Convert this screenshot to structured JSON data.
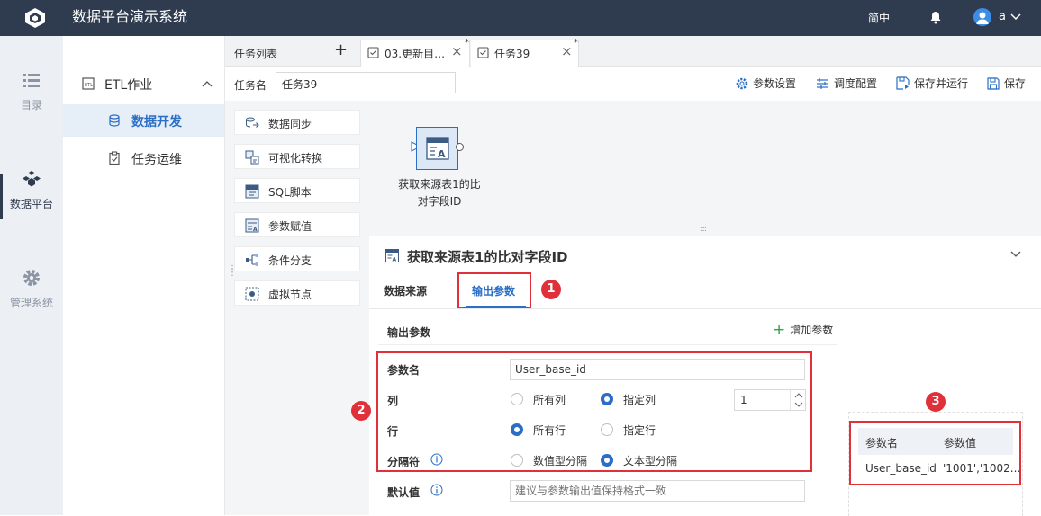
{
  "header": {
    "app_title": "数据平台演示系统",
    "lang_label": "简中",
    "user_name": "a",
    "logo_icon": "cube-logo-icon",
    "bell_icon": "bell-icon",
    "avatar_icon": "user-avatar-icon"
  },
  "left_nav": {
    "items": [
      {
        "label": "目录",
        "icon": "list-icon",
        "active": false
      },
      {
        "label": "数据平台",
        "icon": "cubes-icon",
        "active": true
      },
      {
        "label": "管理系统",
        "icon": "gear-icon",
        "active": false
      }
    ]
  },
  "second_menu": {
    "group_label": "ETL作业",
    "items": [
      {
        "label": "数据开发",
        "selected": true
      },
      {
        "label": "任务运维",
        "selected": false
      }
    ]
  },
  "tabs": {
    "task_list_label": "任务列表",
    "add_symbol": "+",
    "open_tabs": [
      {
        "label": "03.更新目…",
        "modified_mark": "*",
        "active": false
      },
      {
        "label": "任务39",
        "modified_mark": "*",
        "active": true
      }
    ]
  },
  "task_bar": {
    "name_label": "任务名",
    "name_value": "任务39",
    "actions": [
      {
        "label": "参数设置",
        "icon": "gear-small-icon"
      },
      {
        "label": "调度配置",
        "icon": "sliders-icon"
      },
      {
        "label": "保存并运行",
        "icon": "save-run-icon"
      },
      {
        "label": "保存",
        "icon": "save-icon"
      }
    ]
  },
  "palette": {
    "items": [
      {
        "label": "数据同步",
        "icon": "sync-icon"
      },
      {
        "label": "可视化转换",
        "icon": "transform-icon"
      },
      {
        "label": "SQL脚本",
        "icon": "sql-icon"
      },
      {
        "label": "参数赋值",
        "icon": "param-assign-icon"
      },
      {
        "label": "条件分支",
        "icon": "branch-icon"
      },
      {
        "label": "虚拟节点",
        "icon": "virtual-node-icon"
      }
    ]
  },
  "graph": {
    "node_label_line1": "获取来源表1的比",
    "node_label_line2": "对字段ID"
  },
  "panel": {
    "title": "获取来源表1的比对字段ID",
    "tabs": [
      {
        "label": "数据来源",
        "active": false
      },
      {
        "label": "输出参数",
        "active": true
      }
    ],
    "section_title": "输出参数",
    "add_param_label": "增加参数",
    "add_symbol": "+",
    "fields": {
      "param_name_label": "参数名",
      "param_name_value": "User_base_id",
      "column_label": "列",
      "column_options": [
        {
          "label": "所有列",
          "checked": false
        },
        {
          "label": "指定列",
          "checked": true
        }
      ],
      "column_number": "1",
      "row_label": "行",
      "row_options": [
        {
          "label": "所有行",
          "checked": true
        },
        {
          "label": "指定行",
          "checked": false
        }
      ],
      "separator_label": "分隔符",
      "separator_options": [
        {
          "label": "数值型分隔",
          "checked": false
        },
        {
          "label": "文本型分隔",
          "checked": true
        }
      ],
      "default_label": "默认值",
      "default_placeholder": "建议与参数输出值保持格式一致"
    },
    "preview": {
      "headers": [
        "参数名",
        "参数值"
      ],
      "rows": [
        [
          "User_base_id",
          "'1001','1002..."
        ]
      ]
    }
  },
  "annotations": {
    "badges": [
      "1",
      "2",
      "3"
    ],
    "box_color": "#e0303a"
  },
  "colors": {
    "header_bg": "#2f3c4f",
    "accent": "#2a6ec6",
    "selected_bg": "#e6eef7"
  }
}
